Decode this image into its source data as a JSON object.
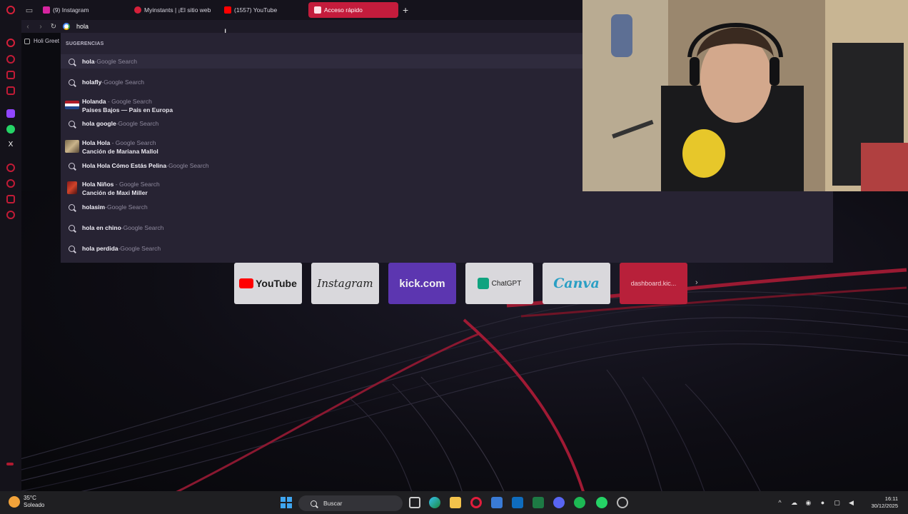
{
  "browser": {
    "tabs": [
      {
        "label": "(9) Instagram",
        "favicon_color": "#d6249f"
      },
      {
        "label": "Myinstants | ¡El sitio web",
        "favicon_color": "#d5203a"
      },
      {
        "label": "(1557) YouTube",
        "favicon_color": "#ff0000"
      },
      {
        "label": "Acceso rápido",
        "favicon_color": "#ffffff",
        "active": true
      }
    ],
    "new_tab_symbol": "+",
    "address_value": "hola",
    "bookmark_label": "Holi Greet"
  },
  "suggestions": {
    "header": "SUGERENCIAS",
    "items": [
      {
        "term": "hola",
        "separator": " - ",
        "source": "Google Search",
        "kind": "search"
      },
      {
        "term": "holafly",
        "separator": " - ",
        "source": "Google Search",
        "kind": "search"
      },
      {
        "term": "Holanda",
        "separator": " - ",
        "source": "Google Search",
        "kind": "entity",
        "subtitle": "Países Bajos — País en Europa"
      },
      {
        "term": "hola google",
        "separator": " - ",
        "source": "Google Search",
        "kind": "search"
      },
      {
        "term": "Hola Hola",
        "separator": " - ",
        "source": "Google Search",
        "kind": "entity",
        "subtitle": "Canción de Mariana Mallol"
      },
      {
        "term": "Hola Hola Cómo Estás Pelina",
        "separator": " - ",
        "source": "Google Search",
        "kind": "search"
      },
      {
        "term": "Hola Niños",
        "separator": " - ",
        "source": "Google Search",
        "kind": "entity",
        "subtitle": "Canción de Maxi Miller"
      },
      {
        "term": "holasim",
        "separator": " - ",
        "source": "Google Search",
        "kind": "search"
      },
      {
        "term": "hola en chino",
        "separator": " - ",
        "source": "Google Search",
        "kind": "search"
      },
      {
        "term": "hola perdida",
        "separator": " - ",
        "source": "Google Search",
        "kind": "search"
      }
    ]
  },
  "speed_dial": {
    "tiles": [
      "YouTube",
      "Instagram",
      "kick.com",
      "ChatGPT",
      "Canva",
      "dashboard.kic..."
    ],
    "more_symbol": "›"
  },
  "taskbar": {
    "weather_temp": "35°C",
    "weather_desc": "Soleado",
    "search_placeholder": "Buscar",
    "time": "16:11",
    "date": "30/12/2025"
  },
  "colors": {
    "accent": "#c41c3c",
    "dropdown_bg": "#272333",
    "kick_tile": "#5c36b0"
  }
}
